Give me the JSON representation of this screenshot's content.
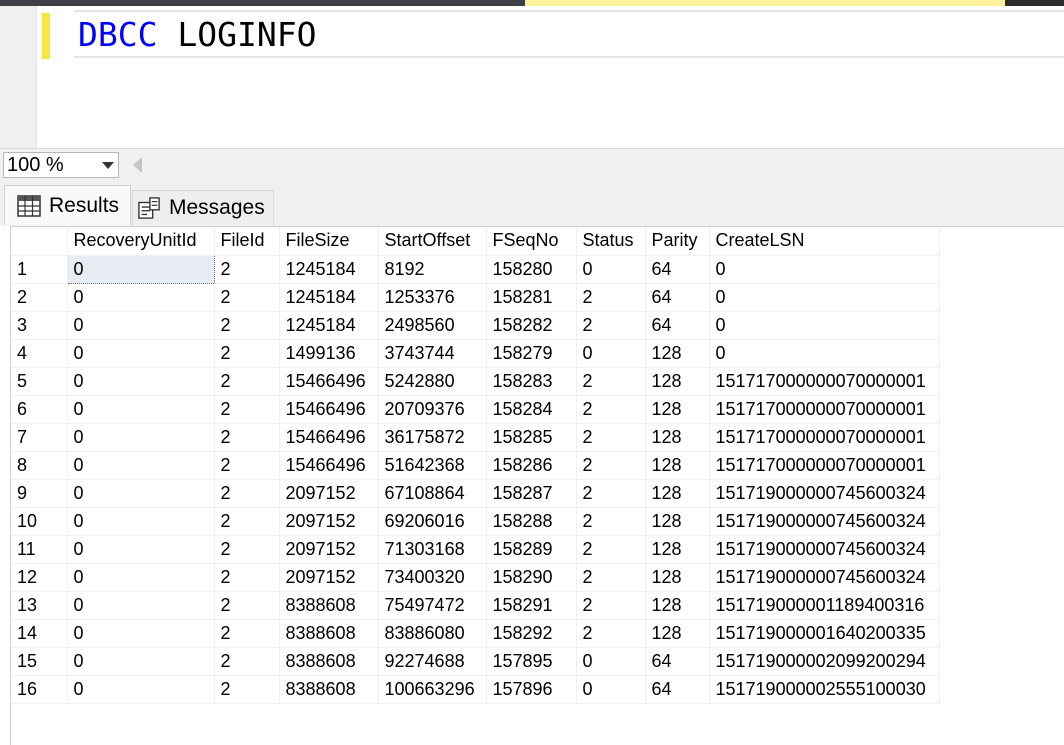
{
  "editor": {
    "keyword": "DBCC",
    "argument": "LOGINFO"
  },
  "zoom": {
    "value": "100 %"
  },
  "result_tabs": [
    {
      "label": "Results",
      "icon": "grid-icon",
      "active": true
    },
    {
      "label": "Messages",
      "icon": "messages-icon",
      "active": false
    }
  ],
  "table": {
    "columns": [
      "",
      "RecoveryUnitId",
      "FileId",
      "FileSize",
      "StartOffset",
      "FSeqNo",
      "Status",
      "Parity",
      "CreateLSN"
    ],
    "rows": [
      [
        "1",
        "0",
        "2",
        "1245184",
        "8192",
        "158280",
        "0",
        "64",
        "0"
      ],
      [
        "2",
        "0",
        "2",
        "1245184",
        "1253376",
        "158281",
        "2",
        "64",
        "0"
      ],
      [
        "3",
        "0",
        "2",
        "1245184",
        "2498560",
        "158282",
        "2",
        "64",
        "0"
      ],
      [
        "4",
        "0",
        "2",
        "1499136",
        "3743744",
        "158279",
        "0",
        "128",
        "0"
      ],
      [
        "5",
        "0",
        "2",
        "15466496",
        "5242880",
        "158283",
        "2",
        "128",
        "151717000000070000001"
      ],
      [
        "6",
        "0",
        "2",
        "15466496",
        "20709376",
        "158284",
        "2",
        "128",
        "151717000000070000001"
      ],
      [
        "7",
        "0",
        "2",
        "15466496",
        "36175872",
        "158285",
        "2",
        "128",
        "151717000000070000001"
      ],
      [
        "8",
        "0",
        "2",
        "15466496",
        "51642368",
        "158286",
        "2",
        "128",
        "151717000000070000001"
      ],
      [
        "9",
        "0",
        "2",
        "2097152",
        "67108864",
        "158287",
        "2",
        "128",
        "151719000000745600324"
      ],
      [
        "10",
        "0",
        "2",
        "2097152",
        "69206016",
        "158288",
        "2",
        "128",
        "151719000000745600324"
      ],
      [
        "11",
        "0",
        "2",
        "2097152",
        "71303168",
        "158289",
        "2",
        "128",
        "151719000000745600324"
      ],
      [
        "12",
        "0",
        "2",
        "2097152",
        "73400320",
        "158290",
        "2",
        "128",
        "151719000000745600324"
      ],
      [
        "13",
        "0",
        "2",
        "8388608",
        "75497472",
        "158291",
        "2",
        "128",
        "151719000001189400316"
      ],
      [
        "14",
        "0",
        "2",
        "8388608",
        "83886080",
        "158292",
        "2",
        "128",
        "151719000001640200335"
      ],
      [
        "15",
        "0",
        "2",
        "8388608",
        "92274688",
        "157895",
        "0",
        "64",
        "151719000002099200294"
      ],
      [
        "16",
        "0",
        "2",
        "8388608",
        "100663296",
        "157896",
        "0",
        "64",
        "151719000002555100030"
      ]
    ]
  }
}
